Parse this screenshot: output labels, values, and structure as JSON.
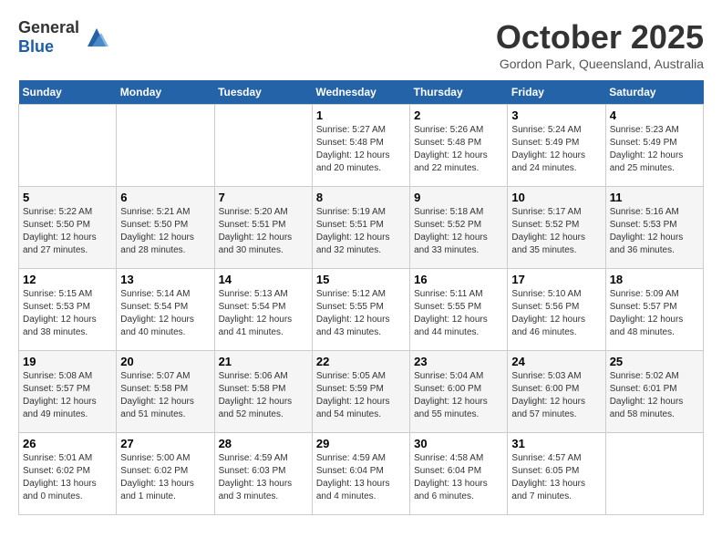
{
  "header": {
    "logo_general": "General",
    "logo_blue": "Blue",
    "month_title": "October 2025",
    "location": "Gordon Park, Queensland, Australia"
  },
  "weekdays": [
    "Sunday",
    "Monday",
    "Tuesday",
    "Wednesday",
    "Thursday",
    "Friday",
    "Saturday"
  ],
  "weeks": [
    [
      {
        "day": "",
        "info": ""
      },
      {
        "day": "",
        "info": ""
      },
      {
        "day": "",
        "info": ""
      },
      {
        "day": "1",
        "info": "Sunrise: 5:27 AM\nSunset: 5:48 PM\nDaylight: 12 hours\nand 20 minutes."
      },
      {
        "day": "2",
        "info": "Sunrise: 5:26 AM\nSunset: 5:48 PM\nDaylight: 12 hours\nand 22 minutes."
      },
      {
        "day": "3",
        "info": "Sunrise: 5:24 AM\nSunset: 5:49 PM\nDaylight: 12 hours\nand 24 minutes."
      },
      {
        "day": "4",
        "info": "Sunrise: 5:23 AM\nSunset: 5:49 PM\nDaylight: 12 hours\nand 25 minutes."
      }
    ],
    [
      {
        "day": "5",
        "info": "Sunrise: 5:22 AM\nSunset: 5:50 PM\nDaylight: 12 hours\nand 27 minutes."
      },
      {
        "day": "6",
        "info": "Sunrise: 5:21 AM\nSunset: 5:50 PM\nDaylight: 12 hours\nand 28 minutes."
      },
      {
        "day": "7",
        "info": "Sunrise: 5:20 AM\nSunset: 5:51 PM\nDaylight: 12 hours\nand 30 minutes."
      },
      {
        "day": "8",
        "info": "Sunrise: 5:19 AM\nSunset: 5:51 PM\nDaylight: 12 hours\nand 32 minutes."
      },
      {
        "day": "9",
        "info": "Sunrise: 5:18 AM\nSunset: 5:52 PM\nDaylight: 12 hours\nand 33 minutes."
      },
      {
        "day": "10",
        "info": "Sunrise: 5:17 AM\nSunset: 5:52 PM\nDaylight: 12 hours\nand 35 minutes."
      },
      {
        "day": "11",
        "info": "Sunrise: 5:16 AM\nSunset: 5:53 PM\nDaylight: 12 hours\nand 36 minutes."
      }
    ],
    [
      {
        "day": "12",
        "info": "Sunrise: 5:15 AM\nSunset: 5:53 PM\nDaylight: 12 hours\nand 38 minutes."
      },
      {
        "day": "13",
        "info": "Sunrise: 5:14 AM\nSunset: 5:54 PM\nDaylight: 12 hours\nand 40 minutes."
      },
      {
        "day": "14",
        "info": "Sunrise: 5:13 AM\nSunset: 5:54 PM\nDaylight: 12 hours\nand 41 minutes."
      },
      {
        "day": "15",
        "info": "Sunrise: 5:12 AM\nSunset: 5:55 PM\nDaylight: 12 hours\nand 43 minutes."
      },
      {
        "day": "16",
        "info": "Sunrise: 5:11 AM\nSunset: 5:55 PM\nDaylight: 12 hours\nand 44 minutes."
      },
      {
        "day": "17",
        "info": "Sunrise: 5:10 AM\nSunset: 5:56 PM\nDaylight: 12 hours\nand 46 minutes."
      },
      {
        "day": "18",
        "info": "Sunrise: 5:09 AM\nSunset: 5:57 PM\nDaylight: 12 hours\nand 48 minutes."
      }
    ],
    [
      {
        "day": "19",
        "info": "Sunrise: 5:08 AM\nSunset: 5:57 PM\nDaylight: 12 hours\nand 49 minutes."
      },
      {
        "day": "20",
        "info": "Sunrise: 5:07 AM\nSunset: 5:58 PM\nDaylight: 12 hours\nand 51 minutes."
      },
      {
        "day": "21",
        "info": "Sunrise: 5:06 AM\nSunset: 5:58 PM\nDaylight: 12 hours\nand 52 minutes."
      },
      {
        "day": "22",
        "info": "Sunrise: 5:05 AM\nSunset: 5:59 PM\nDaylight: 12 hours\nand 54 minutes."
      },
      {
        "day": "23",
        "info": "Sunrise: 5:04 AM\nSunset: 6:00 PM\nDaylight: 12 hours\nand 55 minutes."
      },
      {
        "day": "24",
        "info": "Sunrise: 5:03 AM\nSunset: 6:00 PM\nDaylight: 12 hours\nand 57 minutes."
      },
      {
        "day": "25",
        "info": "Sunrise: 5:02 AM\nSunset: 6:01 PM\nDaylight: 12 hours\nand 58 minutes."
      }
    ],
    [
      {
        "day": "26",
        "info": "Sunrise: 5:01 AM\nSunset: 6:02 PM\nDaylight: 13 hours\nand 0 minutes."
      },
      {
        "day": "27",
        "info": "Sunrise: 5:00 AM\nSunset: 6:02 PM\nDaylight: 13 hours\nand 1 minute."
      },
      {
        "day": "28",
        "info": "Sunrise: 4:59 AM\nSunset: 6:03 PM\nDaylight: 13 hours\nand 3 minutes."
      },
      {
        "day": "29",
        "info": "Sunrise: 4:59 AM\nSunset: 6:04 PM\nDaylight: 13 hours\nand 4 minutes."
      },
      {
        "day": "30",
        "info": "Sunrise: 4:58 AM\nSunset: 6:04 PM\nDaylight: 13 hours\nand 6 minutes."
      },
      {
        "day": "31",
        "info": "Sunrise: 4:57 AM\nSunset: 6:05 PM\nDaylight: 13 hours\nand 7 minutes."
      },
      {
        "day": "",
        "info": ""
      }
    ]
  ]
}
